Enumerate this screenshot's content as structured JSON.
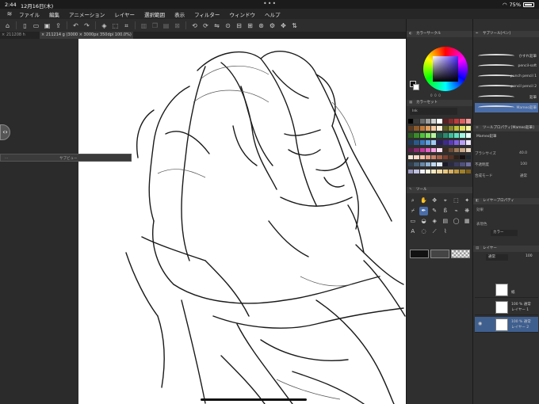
{
  "status": {
    "time": "2:44",
    "date": "12月16日(木)",
    "battery": "75%"
  },
  "menu": [
    "ファイル",
    "編集",
    "アニメーション",
    "レイヤー",
    "選択範囲",
    "表示",
    "フィルター",
    "ウィンドウ",
    "ヘルプ"
  ],
  "tabs": [
    {
      "label": "211208 h"
    },
    {
      "label": "211214 g (3000 × 3000px 350dpi 100.0%)"
    }
  ],
  "float_panel": {
    "left": "...",
    "right": "サブビュー"
  },
  "panels": {
    "color_wheel": {
      "title": "カラーサークル",
      "values": [
        "0",
        "0",
        "0"
      ]
    },
    "color_set": {
      "title": "カラーセット",
      "set_name": "Ink"
    },
    "tool": {
      "title": "ツール"
    },
    "subtool": {
      "title": "サブツール[ペン]",
      "brushes": [
        "かすれ鉛筆",
        "pencil-soft",
        "punch pencil 1",
        "pencil pencil 2",
        "鉛筆",
        "Mameo鉛筆"
      ],
      "selected_index": 5
    },
    "tool_property": {
      "title": "ツールプロパティ[Mameo鉛筆]",
      "brush_label": "Mameo鉛筆",
      "rows": [
        {
          "label": "ブラシサイズ",
          "value": "40.0"
        },
        {
          "label": "不透明度",
          "value": "100"
        },
        {
          "label": "合成モード",
          "value": "通常"
        }
      ]
    },
    "layer_property": {
      "title": "レイヤープロパティ",
      "effect_label": "効果",
      "color_label": "表現色",
      "color_value": "カラー"
    },
    "layer": {
      "title": "レイヤー",
      "blend": "通常",
      "opacity": "100",
      "layers": [
        {
          "name": "紙",
          "sub": ""
        },
        {
          "name": "レイヤー 1",
          "sub": "100 %  通常"
        },
        {
          "name": "レイヤー 2",
          "sub": "100 %  通常"
        }
      ]
    }
  },
  "colors": {
    "accent": "#4a6da8",
    "palette": [
      "#000000",
      "#3a3a3a",
      "#6b6b6b",
      "#9e9e9e",
      "#d0d0d0",
      "#ffffff",
      "#5c1f1f",
      "#8c2a2a",
      "#c03a3a",
      "#e06060",
      "#f4a0a0",
      "#5c3a1f",
      "#8c5a2a",
      "#c07a3a",
      "#e0a060",
      "#f4c8a0",
      "#fff0d8",
      "#5c5c1f",
      "#8c8c2a",
      "#c0c03a",
      "#e0e060",
      "#f4f4a0",
      "#2a5c1f",
      "#3a8c2a",
      "#4ec03a",
      "#7ee060",
      "#b8f4a0",
      "#1f5c4a",
      "#2a8c70",
      "#3ac09a",
      "#60e0c0",
      "#a0f4e0",
      "#e8fff8",
      "#1f3a5c",
      "#2a5a8c",
      "#3a7ac0",
      "#60a0e0",
      "#a0ccf4",
      "#2a1f5c",
      "#3f2a8c",
      "#5a3ac0",
      "#8060e0",
      "#b8a0f4",
      "#f0e8ff",
      "#5c1f4a",
      "#8c2a70",
      "#c03a9a",
      "#e060c0",
      "#f4a0e0",
      "#ffe0f4",
      "#3a2a1f",
      "#6b4a35",
      "#9e7a5a",
      "#c8a888",
      "#e8d4c0",
      "#f8e8d8",
      "#ffd8c8",
      "#ffc0a8",
      "#e8a088",
      "#c88068",
      "#a86048",
      "#804030",
      "#583020",
      "#302018",
      "#181010",
      "#202830",
      "#304050",
      "#486078",
      "#6888a8",
      "#90b0d0",
      "#c0d8f0",
      "#e0ecf8",
      "#1a1a2a",
      "#2a2a44",
      "#3a3a60",
      "#50507c",
      "#7070a0",
      "#9898c0",
      "#c0c0e0",
      "#f0f0ff",
      "#fff8e0",
      "#f8e8c0",
      "#f0d8a0",
      "#e8c880",
      "#d8b060",
      "#c09840",
      "#a08028",
      "#806018"
    ]
  }
}
